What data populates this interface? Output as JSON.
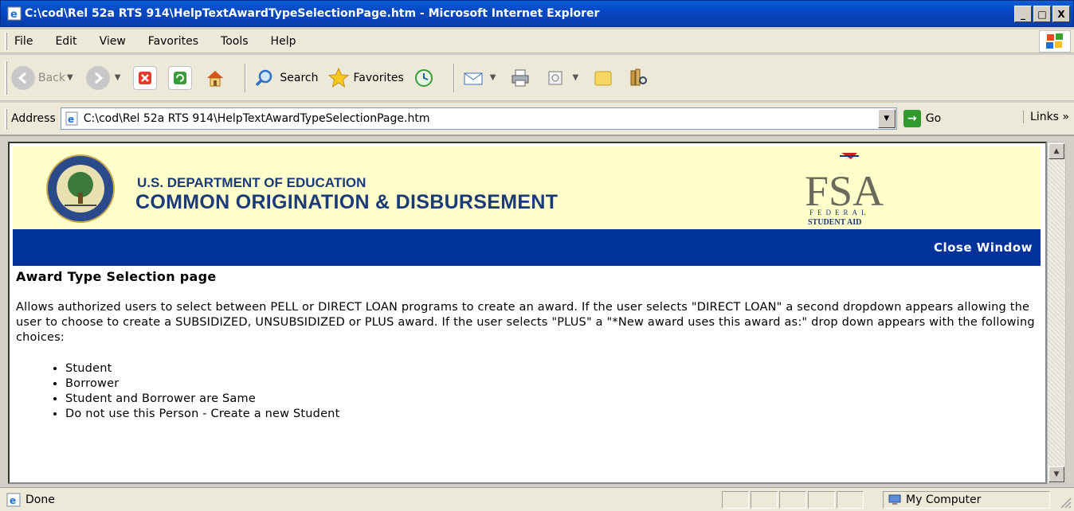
{
  "window": {
    "title": "C:\\cod\\Rel 52a RTS 914\\HelpTextAwardTypeSelectionPage.htm - Microsoft Internet Explorer",
    "minimize": "_",
    "maximize": "□",
    "close": "X"
  },
  "menu": {
    "items": [
      "File",
      "Edit",
      "View",
      "Favorites",
      "Tools",
      "Help"
    ]
  },
  "toolbar": {
    "back": "Back",
    "search": "Search",
    "favorites": "Favorites"
  },
  "address": {
    "label": "Address",
    "url": "C:\\cod\\Rel 52a RTS 914\\HelpTextAwardTypeSelectionPage.htm",
    "go": "Go",
    "links": "Links"
  },
  "banner": {
    "department": "U.S. DEPARTMENT OF EDUCATION",
    "system": "COMMON ORIGINATION & DISBURSEMENT",
    "fsa_logo_text": "FSA",
    "fsa_logo_sub1": "FEDERAL",
    "fsa_logo_sub2": "STUDENT AID"
  },
  "nav": {
    "close_window": "Close Window"
  },
  "content": {
    "heading": "Award Type Selection page",
    "paragraph": "Allows authorized users to select between PELL or DIRECT LOAN programs to create an award. If the user selects \"DIRECT LOAN\" a second dropdown appears allowing the user to choose to create a SUBSIDIZED, UNSUBSIDIZED or PLUS award. If the user selects \"PLUS\" a \"*New award uses this award as:\" drop down appears with the following choices:",
    "choices": [
      "Student",
      "Borrower",
      "Student and Borrower are Same",
      "Do not use this Person - Create a new Student"
    ]
  },
  "status": {
    "text": "Done",
    "zone": "My Computer"
  },
  "colors": {
    "titlebar": "#0548c4",
    "banner_bg": "#ffffcc",
    "navbar": "#003399",
    "logo_text": "#1a3a78"
  }
}
